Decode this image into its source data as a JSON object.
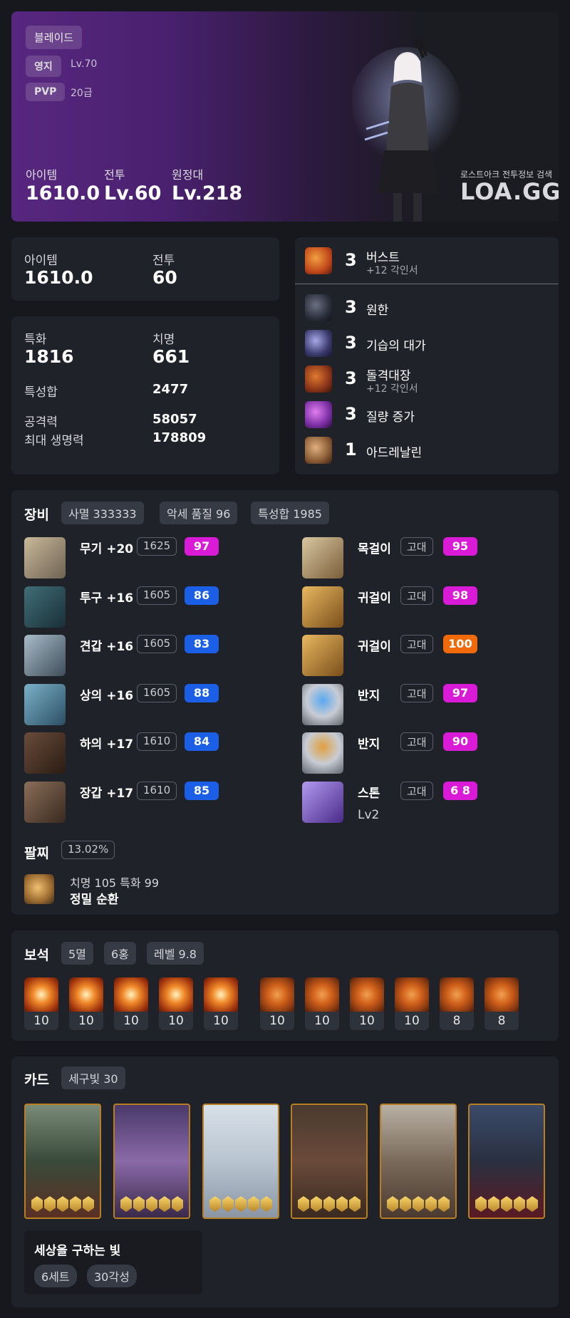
{
  "hero": {
    "class_name": "블레이드",
    "estate_label": "영지",
    "estate_value": "Lv.70",
    "pvp_label": "PVP",
    "pvp_value": "20급",
    "item_label": "아이템",
    "item_value": "1610.0",
    "combat_label": "전투",
    "combat_value": "Lv.60",
    "expedition_label": "원정대",
    "expedition_value": "Lv.218",
    "watermark_sub": "로스트아크 전투정보 검색",
    "watermark": "LOA.GG"
  },
  "summary": {
    "item_label": "아이템",
    "item_value": "1610.0",
    "combat_label": "전투",
    "combat_value": "60"
  },
  "stats": {
    "spec_label": "특화",
    "spec_value": "1816",
    "crit_label": "치명",
    "crit_value": "661",
    "total_label": "특성합",
    "total_value": "2477",
    "atk_label": "공격력",
    "atk_value": "58057",
    "hp_label": "최대 생명력",
    "hp_value": "178809"
  },
  "engravings": [
    {
      "level": "3",
      "name": "버스트",
      "sub": "+12 각인서",
      "icon": "burst-icon",
      "color": "#c2481a"
    },
    {
      "level": "3",
      "name": "원한",
      "sub": "",
      "icon": "grudge-icon",
      "color": "#2a2f3c"
    },
    {
      "level": "3",
      "name": "기습의 대가",
      "sub": "",
      "icon": "ambush-icon",
      "color": "#3a3a6e"
    },
    {
      "level": "3",
      "name": "돌격대장",
      "sub": "+12 각인서",
      "icon": "raid-captain-icon",
      "color": "#8a3418"
    },
    {
      "level": "3",
      "name": "질량 증가",
      "sub": "",
      "icon": "mass-increase-icon",
      "color": "#7a2fa3"
    },
    {
      "level": "1",
      "name": "아드레날린",
      "sub": "",
      "icon": "adrenaline-icon",
      "color": "#8a5a34"
    }
  ],
  "equipment": {
    "title": "장비",
    "tags": [
      "사멸 333333",
      "악세 품질 96",
      "특성합 1985"
    ],
    "left": [
      {
        "name": "무기 +20",
        "ilvl": "1625",
        "quality": "97",
        "qclass": "q-pink",
        "icon": "weapon-icon"
      },
      {
        "name": "투구 +16",
        "ilvl": "1605",
        "quality": "86",
        "qclass": "q-blue",
        "icon": "helmet-icon"
      },
      {
        "name": "견갑 +16",
        "ilvl": "1605",
        "quality": "83",
        "qclass": "q-blue",
        "icon": "shoulder-icon"
      },
      {
        "name": "상의 +16",
        "ilvl": "1605",
        "quality": "88",
        "qclass": "q-blue",
        "icon": "chest-icon"
      },
      {
        "name": "하의 +17",
        "ilvl": "1610",
        "quality": "84",
        "qclass": "q-blue",
        "icon": "pants-icon"
      },
      {
        "name": "장갑 +17",
        "ilvl": "1610",
        "quality": "85",
        "qclass": "q-blue",
        "icon": "gloves-icon"
      }
    ],
    "right": [
      {
        "name": "목걸이",
        "grade": "고대",
        "quality": "95",
        "qclass": "q-pink",
        "icon": "necklace-icon"
      },
      {
        "name": "귀걸이",
        "grade": "고대",
        "quality": "98",
        "qclass": "q-pink",
        "icon": "earring-icon"
      },
      {
        "name": "귀걸이",
        "grade": "고대",
        "quality": "100",
        "qclass": "q-orange",
        "icon": "earring-icon"
      },
      {
        "name": "반지",
        "grade": "고대",
        "quality": "97",
        "qclass": "q-pink",
        "icon": "ring-icon"
      },
      {
        "name": "반지",
        "grade": "고대",
        "quality": "90",
        "qclass": "q-pink",
        "icon": "ring-icon"
      },
      {
        "name": "스톤",
        "grade": "고대",
        "quality": "6 8",
        "qclass": "q-pink",
        "icon": "stone-icon",
        "extra": "Lv2"
      }
    ],
    "bracelet_label": "팔찌",
    "bracelet_pct": "13.02%",
    "bracelet_line1": "치명 105  특화 99",
    "bracelet_line2": "정밀  순환"
  },
  "gems": {
    "title": "보석",
    "tags": [
      "5멸",
      "6홍",
      "레벨 9.8"
    ],
    "levels": [
      "10",
      "10",
      "10",
      "10",
      "10",
      "10",
      "10",
      "10",
      "10",
      "8",
      "8"
    ],
    "types": [
      "doom",
      "doom",
      "doom",
      "doom",
      "doom",
      "crimson",
      "crimson",
      "crimson",
      "crimson",
      "crimson",
      "crimson"
    ]
  },
  "cards": {
    "title": "카드",
    "tag": "세구빛 30",
    "set_name": "세상을 구하는 빛",
    "set_tags": [
      "6세트",
      "30각성"
    ],
    "names": [
      "card-elf-mage",
      "card-twin-goddess",
      "card-winged-angel",
      "card-dwarf-warrior",
      "card-knight",
      "card-dark-hunter"
    ]
  }
}
